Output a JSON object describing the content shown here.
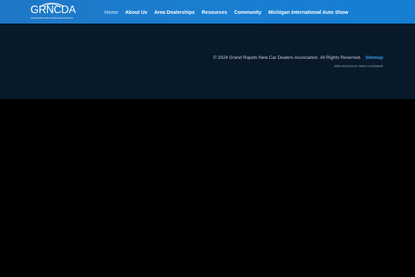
{
  "header": {
    "logo_text": "GRNCDA",
    "logo_subtext": "GRAND RAPIDS NEW CAR DEALERS ASSOCIATION",
    "background_color": "#1a7ed1"
  },
  "nav": {
    "items": [
      {
        "label": "Home",
        "active": true
      },
      {
        "label": "About Us",
        "active": false
      },
      {
        "label": "Area Dealerships",
        "active": false
      },
      {
        "label": "Resources",
        "active": false
      },
      {
        "label": "Community",
        "active": false
      },
      {
        "label": "Michigan International Auto Show",
        "active": false
      }
    ],
    "active_color": "#a9d3f5"
  },
  "footer": {
    "copyright": "© 2024 Grand Rapids New Car Dealers Association. All Rights Reserved.",
    "sitemap_label": "Sitemap",
    "web_design": "WEB DESIGN BY WEB ASCENDER",
    "background_color": "#08192a",
    "link_color": "#3aa0ec"
  }
}
